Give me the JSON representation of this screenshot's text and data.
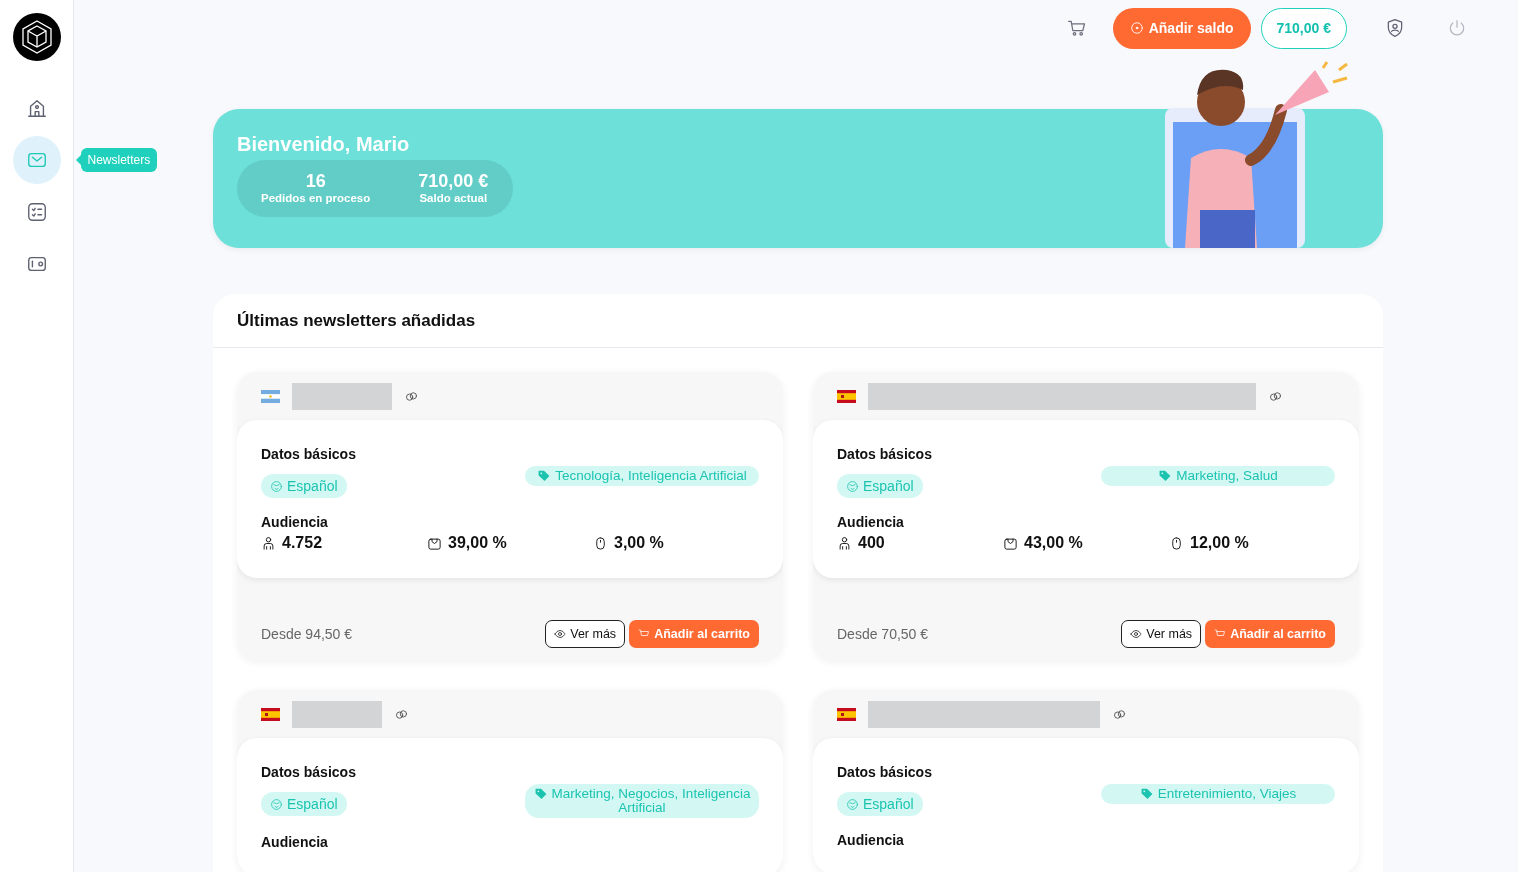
{
  "sidebar": {
    "items": [
      {
        "selected": false
      },
      {
        "selected": true,
        "tooltip": "Newsletters"
      },
      {
        "selected": false
      },
      {
        "selected": false
      }
    ]
  },
  "header": {
    "add_balance": "Añadir saldo",
    "balance": "710,00 €"
  },
  "banner": {
    "title": "Bienvenido, Mario",
    "stats": [
      {
        "value": "16",
        "label": "Pedidos en proceso"
      },
      {
        "value": "710,00 €",
        "label": "Saldo actual"
      }
    ]
  },
  "section": {
    "title": "Últimas newsletters añadidas",
    "cards": [
      {
        "kind": "argentina",
        "basics_title": "Datos básicos",
        "language": "Español",
        "topics": "Tecnología, Inteligencia Artificial",
        "audience_title": "Audiencia",
        "stats": [
          {
            "kind": "subscribers",
            "value": "4.752"
          },
          {
            "kind": "opens",
            "value": "39,00 %"
          },
          {
            "kind": "clicks",
            "value": "3,00 %"
          }
        ],
        "price": "Desde 94,50 €",
        "more": "Ver más",
        "add": "Añadir al carrito"
      },
      {
        "kind": "spain",
        "basics_title": "Datos básicos",
        "language": "Español",
        "topics": "Marketing, Salud",
        "audience_title": "Audiencia",
        "stats": [
          {
            "kind": "subscribers",
            "value": "400"
          },
          {
            "kind": "opens",
            "value": "43,00 %"
          },
          {
            "kind": "clicks",
            "value": "12,00 %"
          }
        ],
        "price": "Desde 70,50 €",
        "more": "Ver más",
        "add": "Añadir al carrito"
      },
      {
        "kind": "spain",
        "basics_title": "Datos básicos",
        "language": "Español",
        "topics": "Marketing, Negocios, Inteligencia Artificial",
        "audience_title": "Audiencia"
      },
      {
        "kind": "spain",
        "basics_title": "Datos básicos",
        "language": "Español",
        "topics": "Entretenimiento, Viajes",
        "audience_title": "Audiencia"
      }
    ]
  }
}
